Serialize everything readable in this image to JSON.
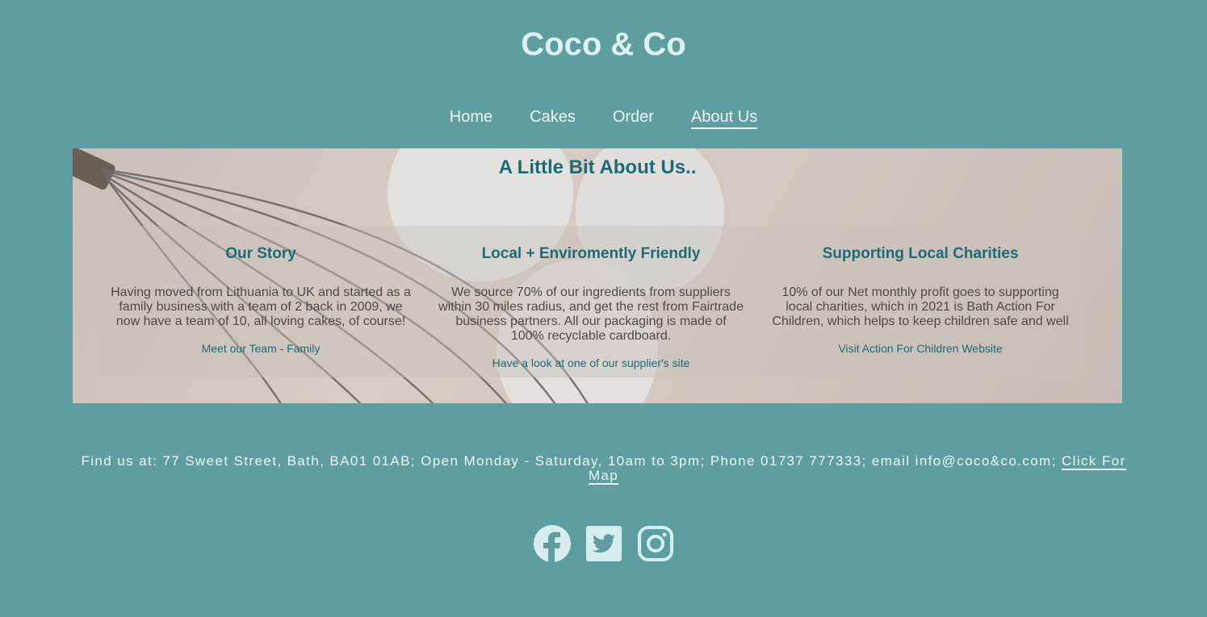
{
  "site": {
    "title": "Coco & Co"
  },
  "nav": {
    "items": [
      {
        "label": "Home",
        "active": false
      },
      {
        "label": "Cakes",
        "active": false
      },
      {
        "label": "Order",
        "active": false
      },
      {
        "label": "About Us",
        "active": true
      }
    ]
  },
  "about": {
    "title": "A Little Bit About Us..",
    "columns": [
      {
        "heading": "Our Story",
        "text": "Having moved from Lithuania to UK and started as a family business with a team of 2 back in 2009, we now have a team of 10, all loving cakes, of course!",
        "link": "Meet our Team - Family"
      },
      {
        "heading": "Local + Enviromently Friendly",
        "text": "We source 70% of our ingredients from suppliers within 30 miles radius, and get the rest from Fairtrade business partners. All our packaging is made of 100% recyclable cardboard.",
        "link": "Have a look at one of our supplier's site"
      },
      {
        "heading": "Supporting Local Charities",
        "text": "10% of our Net monthly profit goes to supporting local charities, which in 2021 is Bath Action For Children, which helps to keep children safe and well",
        "link": "Visit Action For Children Website"
      }
    ]
  },
  "footer": {
    "text": "Find us at: 77 Sweet Street, Bath, BA01 01AB; Open Monday - Saturday, 10am to 3pm; Phone 01737 777333; email info@coco&co.com;",
    "map_link": "Click For Map"
  },
  "social": [
    "facebook-icon",
    "twitter-icon",
    "instagram-icon"
  ],
  "colors": {
    "background": "#5f9ea0",
    "heading_teal": "#1e6b77",
    "light_text": "#eaf6f6"
  }
}
